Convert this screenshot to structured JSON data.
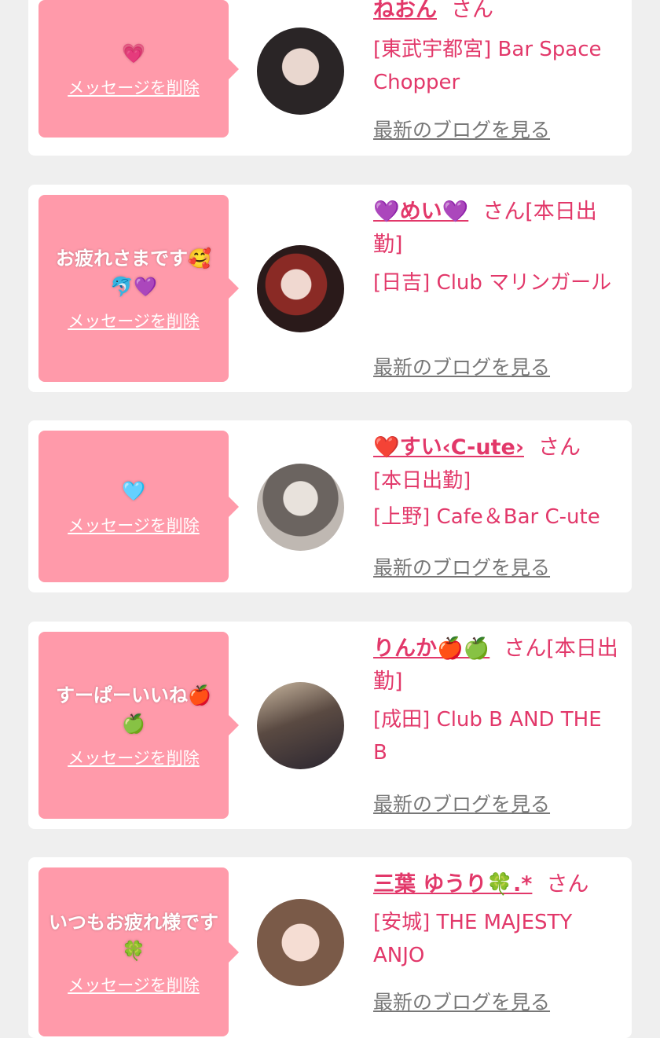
{
  "cards": [
    {
      "message": "💗",
      "delete_label": "メッセージを削除",
      "name": "ねおん",
      "suffix": "さん",
      "shop": "[東武宇都宮] Bar Space Chopper",
      "blog_label": "最新のブログを見る"
    },
    {
      "message": "お疲れさまです🥰🐬💜",
      "delete_label": "メッセージを削除",
      "name": "💜めい💜",
      "suffix": "さん[本日出勤]",
      "shop": "[日吉] Club マリンガール",
      "blog_label": "最新のブログを見る"
    },
    {
      "message": "🩵",
      "delete_label": "メッセージを削除",
      "name": "❤️すい‹C-ute›",
      "suffix": "さん",
      "status": "[本日出勤]",
      "shop": "[上野] Cafe＆Bar C-ute",
      "blog_label": "最新のブログを見る"
    },
    {
      "message": "すーぱーいいね🍎🍏",
      "delete_label": "メッセージを削除",
      "name": "りんか🍎🍏",
      "suffix": "さん[本日出勤]",
      "shop": "[成田] Club B AND THE B",
      "blog_label": "最新のブログを見る"
    },
    {
      "message": "いつもお疲れ様です🍀",
      "delete_label": "メッセージを削除",
      "name": "三葉 ゆうり🍀.*",
      "suffix": "さん",
      "shop": "[安城] THE MAJESTY ANJO",
      "blog_label": "最新のブログを見る"
    }
  ],
  "colors": {
    "background": "#efefef",
    "card": "#ffffff",
    "bubble": "#ff9aaa",
    "accent": "#e2386a",
    "link_gray": "#777777"
  }
}
